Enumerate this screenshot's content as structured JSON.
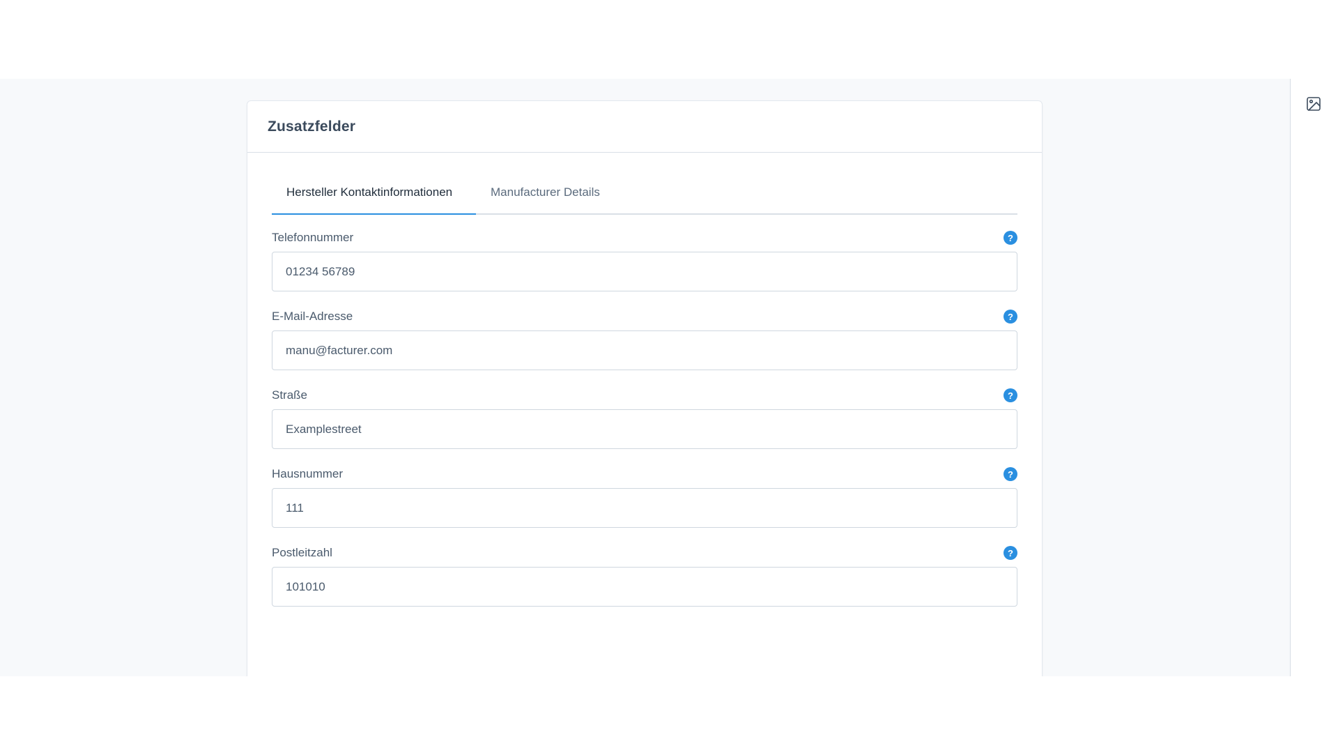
{
  "card": {
    "title": "Zusatzfelder"
  },
  "tabs": [
    {
      "label": "Hersteller Kontaktinformationen",
      "active": true
    },
    {
      "label": "Manufacturer Details",
      "active": false
    }
  ],
  "fields": [
    {
      "label": "Telefonnummer",
      "value": "01234 56789",
      "help": "?"
    },
    {
      "label": "E-Mail-Adresse",
      "value": "manu@facturer.com",
      "help": "?"
    },
    {
      "label": "Straße",
      "value": "Examplestreet",
      "help": "?"
    },
    {
      "label": "Hausnummer",
      "value": "111",
      "help": "?"
    },
    {
      "label": "Postleitzahl",
      "value": "101010",
      "help": "?"
    }
  ],
  "icons": {
    "rail": "image-icon",
    "help": "question-circle-icon"
  },
  "colors": {
    "accent": "#2a8fe0",
    "background": "#f7f9fb"
  }
}
